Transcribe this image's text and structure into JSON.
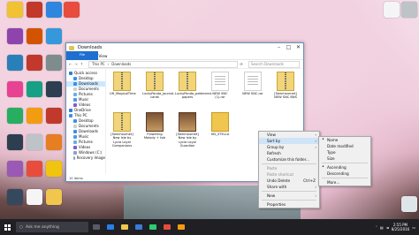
{
  "window": {
    "title": "Downloads",
    "ribbon_tabs": [
      "File",
      "Home",
      "Share",
      "View"
    ],
    "address": [
      "This PC",
      "Downloads"
    ],
    "search_placeholder": "Search Downloads",
    "controls": {
      "min": "–",
      "max": "□",
      "close": "✕"
    }
  },
  "sidebar": {
    "items": [
      {
        "label": "Quick access",
        "icon": "star-icon",
        "sub": false,
        "color": "#2f7fd8"
      },
      {
        "label": "Desktop",
        "icon": "desktop-icon",
        "sub": true,
        "color": "#3a90e6"
      },
      {
        "label": "Downloads",
        "icon": "download-icon",
        "sub": true,
        "color": "#3a90e6"
      },
      {
        "label": "Documents",
        "icon": "documents-icon",
        "sub": true,
        "color": "#cfcfcf"
      },
      {
        "label": "Pictures",
        "icon": "pictures-icon",
        "sub": true,
        "color": "#6ab0e6"
      },
      {
        "label": "Music",
        "icon": "music-icon",
        "sub": true,
        "color": "#4b9be0"
      },
      {
        "label": "Videos",
        "icon": "videos-icon",
        "sub": true,
        "color": "#7b5cd6"
      },
      {
        "label": "OneDrive",
        "icon": "cloud-icon",
        "sub": false,
        "color": "#2f7fd8"
      },
      {
        "label": "This PC",
        "icon": "computer-icon",
        "sub": false,
        "color": "#3a90e6"
      },
      {
        "label": "Desktop",
        "icon": "desktop-icon",
        "sub": true,
        "color": "#3a90e6"
      },
      {
        "label": "Documents",
        "icon": "documents-icon",
        "sub": true,
        "color": "#cfcfcf"
      },
      {
        "label": "Downloads",
        "icon": "download-icon",
        "sub": true,
        "color": "#3a90e6"
      },
      {
        "label": "Music",
        "icon": "music-icon",
        "sub": true,
        "color": "#4b9be0"
      },
      {
        "label": "Pictures",
        "icon": "pictures-icon",
        "sub": true,
        "color": "#6ab0e6"
      },
      {
        "label": "Videos",
        "icon": "videos-icon",
        "sub": true,
        "color": "#7b5cd6"
      },
      {
        "label": "Windows (C:)",
        "icon": "drive-icon",
        "sub": true,
        "color": "#8aa4bf"
      },
      {
        "label": "Recovery Image",
        "icon": "drive-icon",
        "sub": true,
        "color": "#8aa4bf"
      }
    ]
  },
  "files": [
    {
      "label": "UH_MagicalTime",
      "type": "zip"
    },
    {
      "label": "LuckyPanda_journal-cards",
      "type": "zip"
    },
    {
      "label": "LuckyPanda_patterned-papers",
      "type": "zip"
    },
    {
      "label": "NEW SNC (1).rar",
      "type": "doc"
    },
    {
      "label": "NEW SNC.rar",
      "type": "doc"
    },
    {
      "label": "[Seechoumet] NEW SNC BNS",
      "type": "zip"
    },
    {
      "label": "[Seechoumet] New Isle by Lycia Loyal Companions",
      "type": "zip"
    },
    {
      "label": "Flowering Melody + Isle",
      "type": "book"
    },
    {
      "label": "[Seechoumet] New Isle by Lycia Loyal Guardian",
      "type": "book"
    },
    {
      "label": "HD_STELLA",
      "type": "folder"
    }
  ],
  "status": "10 items",
  "context_menu": {
    "items": [
      {
        "label": "View",
        "submenu": true
      },
      {
        "label": "Sort by",
        "submenu": true,
        "highlight": true
      },
      {
        "label": "Group by",
        "submenu": true
      },
      {
        "label": "Refresh"
      },
      {
        "label": "Customize this folder..."
      },
      {
        "sep": true
      },
      {
        "label": "Paste",
        "disabled": true
      },
      {
        "label": "Paste shortcut",
        "disabled": true
      },
      {
        "label": "Undo Delete",
        "shortcut": "Ctrl+Z"
      },
      {
        "label": "Share with",
        "submenu": true
      },
      {
        "sep": true
      },
      {
        "label": "New",
        "submenu": true
      },
      {
        "sep": true
      },
      {
        "label": "Properties"
      }
    ]
  },
  "sort_menu": {
    "items": [
      {
        "label": "Name",
        "bullet": true
      },
      {
        "label": "Date modified"
      },
      {
        "label": "Type"
      },
      {
        "label": "Size"
      },
      {
        "sep": true
      },
      {
        "label": "Ascending",
        "bullet": true
      },
      {
        "label": "Descending"
      },
      {
        "sep": true
      },
      {
        "label": "More..."
      }
    ]
  },
  "taskbar": {
    "search_placeholder": "Ask me anything",
    "time": "2:55 PM",
    "date": "8/25/2016"
  }
}
